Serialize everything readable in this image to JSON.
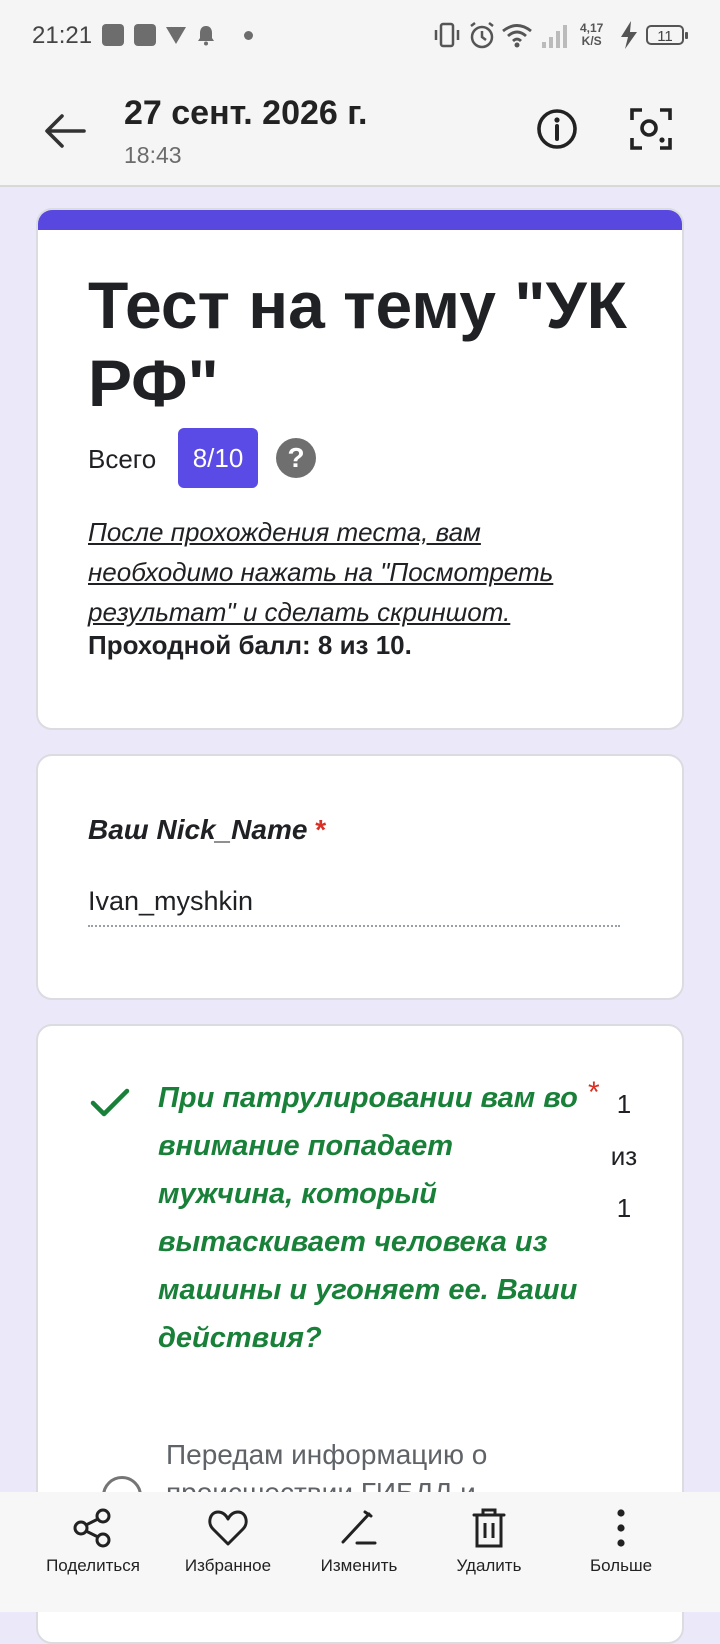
{
  "status_bar": {
    "time": "21:21",
    "net_speed_top": "4,17",
    "net_speed_bottom": "K/S",
    "battery": "11"
  },
  "app_bar": {
    "title": "27 сент. 2026 г.",
    "subtitle": "18:43"
  },
  "form": {
    "title": "Тест на тему \"УК РФ\"",
    "total_label": "Всего",
    "score": "8/10",
    "help_glyph": "?",
    "description": "После прохождения теста, вам необходимо нажать на \"Посмотреть результат\" и сделать скриншот.",
    "pass_score": "Проходной балл: 8 из 10.",
    "accent_color": "#5848e0"
  },
  "nick": {
    "label": "Ваш Nick_Name",
    "required_mark": "*",
    "value": "Ivan_myshkin"
  },
  "question": {
    "text": "При патрулировании вам во внимание попадает мужчина, который вытаскивает человека из машины и угоняет ее. Ваши действия?",
    "required_mark": "*",
    "points": "1 из 1",
    "correct_color": "#188038",
    "option_text": "Передам информацию о происшествии ГИБДД и"
  },
  "bottom_bar": {
    "share": "Поделиться",
    "favorite": "Избранное",
    "edit": "Изменить",
    "delete": "Удалить",
    "more": "Больше"
  },
  "icons": [
    "back-arrow-icon",
    "info-icon",
    "lens-icon",
    "check-icon",
    "help-icon",
    "share-icon",
    "heart-icon",
    "edit-icon",
    "trash-icon",
    "more-icon"
  ]
}
